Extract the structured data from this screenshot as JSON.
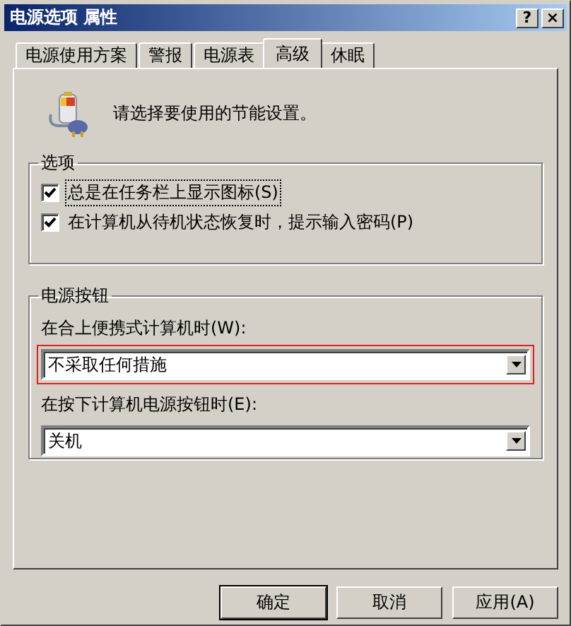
{
  "window": {
    "title": "电源选项 属性",
    "title_buttons": [
      "?",
      "×"
    ]
  },
  "tabs": [
    {
      "label": "电源使用方案",
      "selected": false
    },
    {
      "label": "警报",
      "selected": false
    },
    {
      "label": "电源表",
      "selected": false
    },
    {
      "label": "高级",
      "selected": true
    },
    {
      "label": "休眠",
      "selected": false
    }
  ],
  "intro": "请选择要使用的节能设置。",
  "options_group": {
    "title": "选项",
    "items": [
      {
        "label": "总是在任务栏上显示图标(S)",
        "checked": true,
        "focused": true
      },
      {
        "label": "在计算机从待机状态恢复时，提示输入密码(P)",
        "checked": true,
        "focused": false
      }
    ]
  },
  "power_buttons_group": {
    "title": "电源按钮",
    "fields": [
      {
        "label": "在合上便携式计算机时(W):",
        "value": "不采取任何措施",
        "highlighted": true
      },
      {
        "label": "在按下计算机电源按钮时(E):",
        "value": "关机",
        "highlighted": false
      }
    ]
  },
  "buttons": [
    {
      "label": "确定",
      "default": true
    },
    {
      "label": "取消",
      "default": false
    },
    {
      "label": "应用(A)",
      "default": false
    }
  ]
}
